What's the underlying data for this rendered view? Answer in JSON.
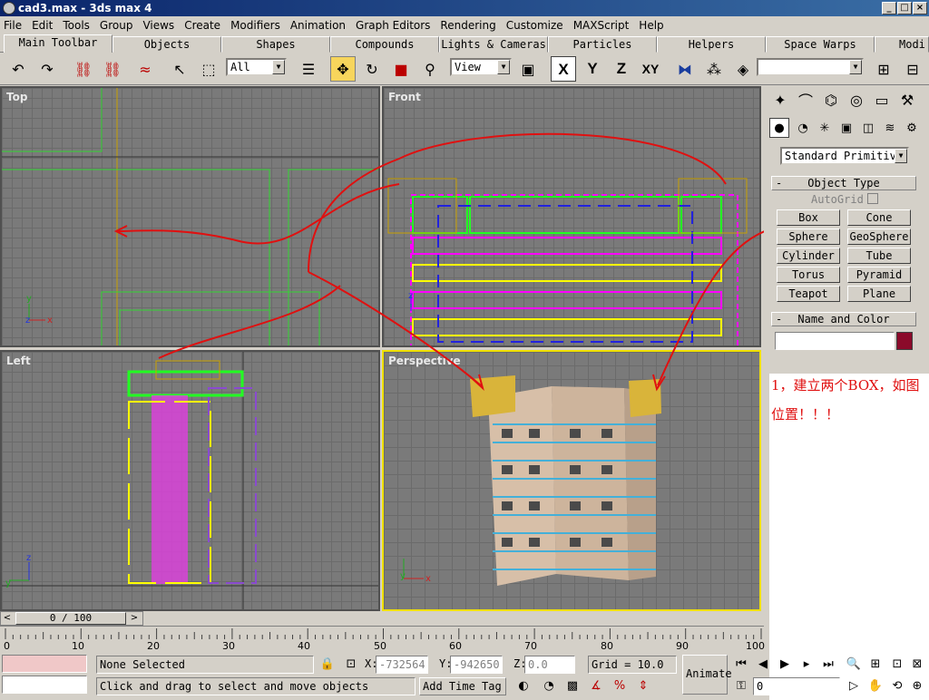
{
  "window": {
    "title": "cad3.max - 3ds max 4",
    "min": "_",
    "max": "□",
    "close": "×"
  },
  "menu": [
    "File",
    "Edit",
    "Tools",
    "Group",
    "Views",
    "Create",
    "Modifiers",
    "Animation",
    "Graph Editors",
    "Rendering",
    "Customize",
    "MAXScript",
    "Help"
  ],
  "tabs": [
    "Main Toolbar",
    "Objects",
    "Shapes",
    "Compounds",
    "Lights & Cameras",
    "Particles",
    "Helpers",
    "Space Warps",
    "Modi"
  ],
  "toolbar": {
    "filter_value": "All",
    "coord_value": "View",
    "axes": [
      "X",
      "Y",
      "Z",
      "XY"
    ],
    "named_sel": ""
  },
  "viewports": {
    "top": "Top",
    "front": "Front",
    "left": "Left",
    "perspective": "Perspective"
  },
  "command_panel": {
    "primitive_type": "Standard Primitiv",
    "object_type_title": "Object Type",
    "autogrid": "AutoGrid",
    "buttons": [
      "Box",
      "Cone",
      "Sphere",
      "GeoSphere",
      "Cylinder",
      "Tube",
      "Torus",
      "Pyramid",
      "Teapot",
      "Plane"
    ],
    "name_color_title": "Name and Color",
    "name_value": "",
    "color": "#8b0a2a",
    "note_line1": "1，建立两个BOX，如图",
    "note_line2": "位置！！！"
  },
  "timeline": {
    "slider": "0 / 100",
    "ticks": [
      "0",
      "10",
      "20",
      "30",
      "40",
      "50",
      "60",
      "70",
      "80",
      "90",
      "100"
    ]
  },
  "status": {
    "selection": "None Selected",
    "prompt": "Click and drag to select and move objects",
    "x_label": "X:",
    "x_value": "-732564.",
    "y_label": "Y:",
    "y_value": "-942650.",
    "z_label": "Z:",
    "z_value": "0.0",
    "grid": "Grid = 10.0",
    "add_time_tag": "Add Time Tag",
    "animate": "Animate",
    "frame": "0"
  }
}
